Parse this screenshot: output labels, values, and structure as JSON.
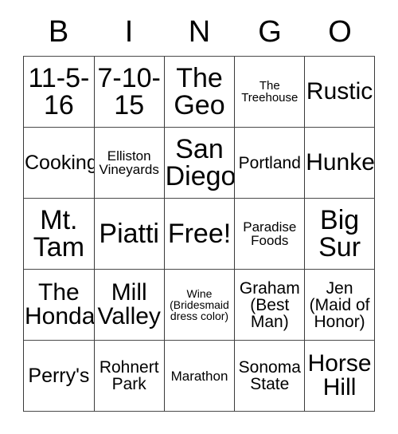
{
  "card": {
    "title": "BINGO",
    "headers": [
      "B",
      "I",
      "N",
      "G",
      "O"
    ],
    "rows": [
      [
        {
          "text": "11-5-\n16",
          "size": "t-xl"
        },
        {
          "text": "7-10-\n15",
          "size": "t-xl"
        },
        {
          "text": "The\nGeo",
          "size": "t-xl"
        },
        {
          "text": "The\nTreehouse",
          "size": "t-xxs"
        },
        {
          "text": "Rustic",
          "size": "t-lg"
        }
      ],
      [
        {
          "text": "Cooking",
          "size": "t-md"
        },
        {
          "text": "Elliston\nVineyards",
          "size": "t-xs"
        },
        {
          "text": "San\nDiego",
          "size": "t-xl"
        },
        {
          "text": "Portland",
          "size": "t-sm"
        },
        {
          "text": "Hunker",
          "size": "t-lg"
        }
      ],
      [
        {
          "text": "Mt.\nTam",
          "size": "t-xl"
        },
        {
          "text": "Piatti",
          "size": "t-xl"
        },
        {
          "text": "Free!",
          "size": "t-xl"
        },
        {
          "text": "Paradise\nFoods",
          "size": "t-xs"
        },
        {
          "text": "Big\nSur",
          "size": "t-xl"
        }
      ],
      [
        {
          "text": "The\nHonda",
          "size": "t-lg"
        },
        {
          "text": "Mill\nValley",
          "size": "t-lg"
        },
        {
          "text": "Wine\n(Bridesmaid\ndress color)",
          "size": "t-tiny"
        },
        {
          "text": "Graham\n(Best\nMan)",
          "size": "t-sm"
        },
        {
          "text": "Jen\n(Maid of\nHonor)",
          "size": "t-sm"
        }
      ],
      [
        {
          "text": "Perry's",
          "size": "t-md"
        },
        {
          "text": "Rohnert\nPark",
          "size": "t-sm"
        },
        {
          "text": "Marathon",
          "size": "t-xs"
        },
        {
          "text": "Sonoma\nState",
          "size": "t-sm"
        },
        {
          "text": "Horse\nHill",
          "size": "t-lg"
        }
      ]
    ],
    "free_space": {
      "row": 2,
      "col": 2,
      "label": "Free!"
    },
    "colors": {
      "background": "#ffffff",
      "text": "#000000",
      "border": "#3a3a3a"
    }
  }
}
